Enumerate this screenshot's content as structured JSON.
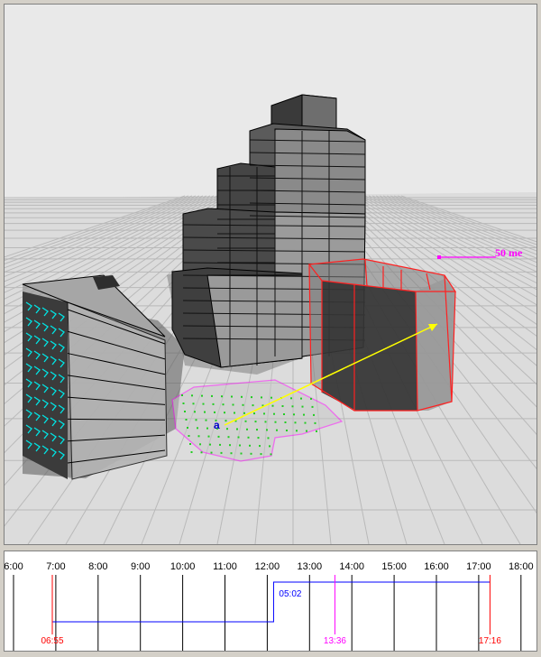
{
  "viewport": {
    "scale_label": "50 me",
    "point_label": "a",
    "colors": {
      "sky": "#e8e8e8",
      "ground": "#dcdcdc",
      "grid": "#b8b8b8",
      "selected_outline": "#ff2020",
      "area_outline": "#ff00ff",
      "area_points": "#22cc22",
      "ray": "#ffff00",
      "window_highlight": "#00e5e5"
    }
  },
  "timeline": {
    "hours": [
      "6:00",
      "7:00",
      "8:00",
      "9:00",
      "10:00",
      "11:00",
      "12:00",
      "13:00",
      "14:00",
      "15:00",
      "16:00",
      "17:00",
      "18:00"
    ],
    "sunrise_label": "06:55",
    "sunset_label": "17:16",
    "noon_label": "13:36",
    "duration_label": "05:02",
    "sunrise_hour": 6.917,
    "sunset_hour": 17.267,
    "noon_hour": 13.6,
    "shade_start_hour": 12.15,
    "colors": {
      "sunrise_sunset": "#ff0000",
      "noon": "#ff00ff",
      "duration": "#0000ff"
    }
  }
}
